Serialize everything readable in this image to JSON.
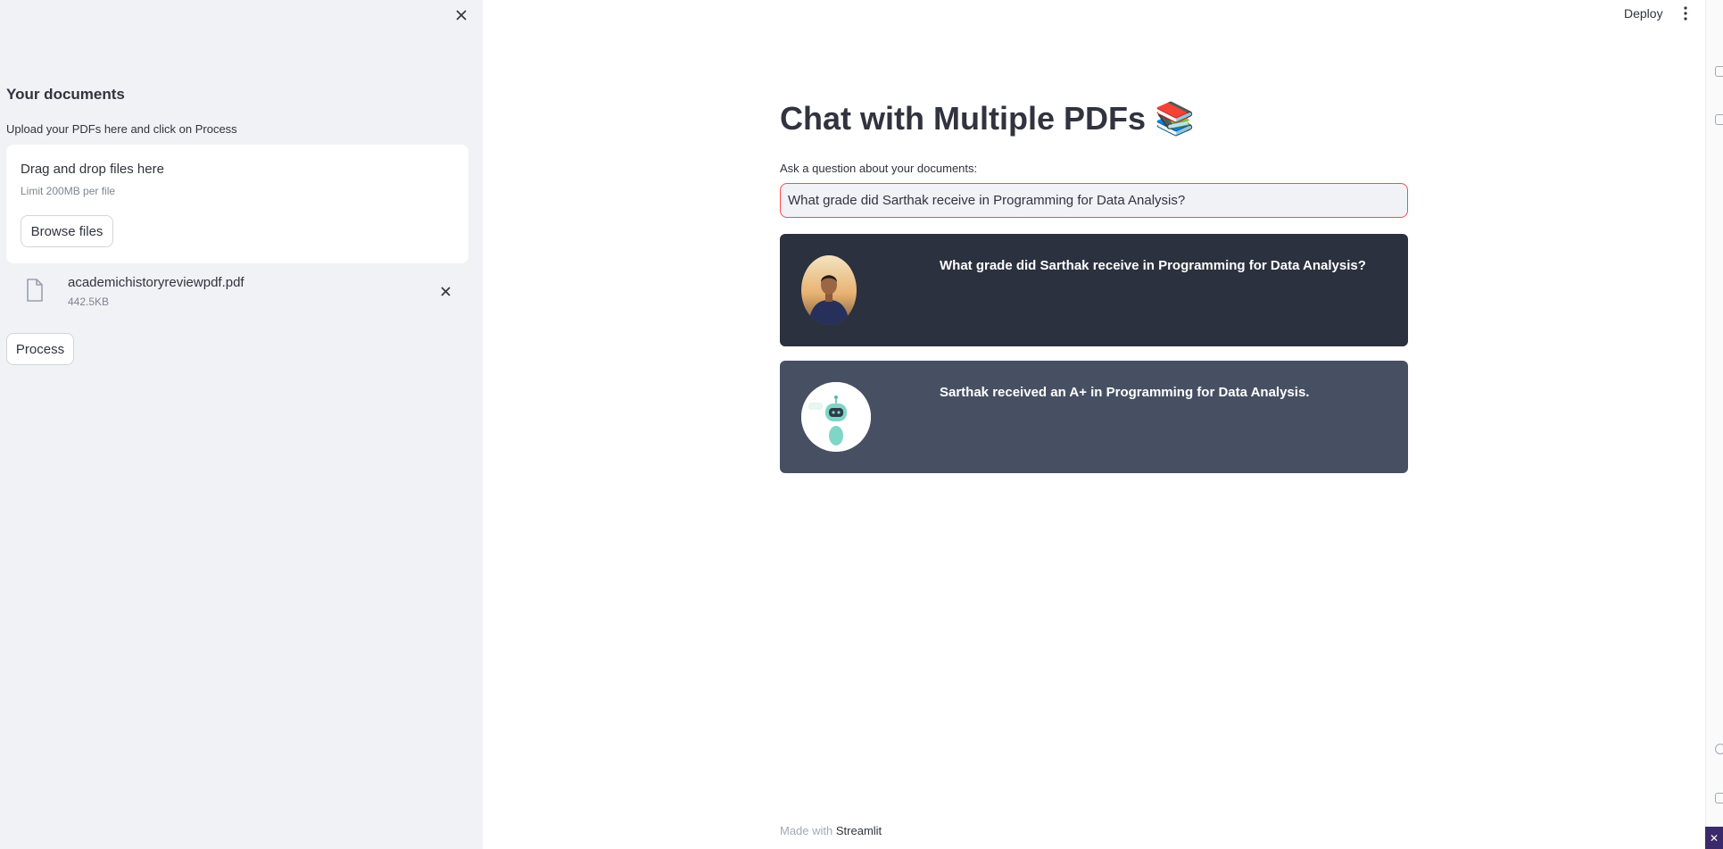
{
  "sidebar": {
    "heading": "Your documents",
    "subtext": "Upload your PDFs here and click on Process",
    "dropzone": {
      "title": "Drag and drop files here",
      "limit": "Limit 200MB per file",
      "browse_label": "Browse files"
    },
    "file": {
      "name": "academichistoryreviewpdf.pdf",
      "size": "442.5KB"
    },
    "process_label": "Process"
  },
  "header": {
    "deploy_label": "Deploy"
  },
  "main": {
    "title": "Chat with Multiple PDFs 📚",
    "input_label": "Ask a question about your documents:",
    "input_value": "What grade did Sarthak receive in Programming for Data Analysis?",
    "messages": [
      {
        "role": "user",
        "text": "What grade did Sarthak receive in Programming for Data Analysis?"
      },
      {
        "role": "bot",
        "text": "Sarthak received an A+ in Programming for Data Analysis."
      }
    ]
  },
  "footer": {
    "prefix": "Made with",
    "link": "Streamlit"
  },
  "colors": {
    "sidebar_bg": "#f0f2f6",
    "user_msg_bg": "#2b313e",
    "bot_msg_bg": "#475063",
    "input_border_focus": "#ff4b4b"
  }
}
